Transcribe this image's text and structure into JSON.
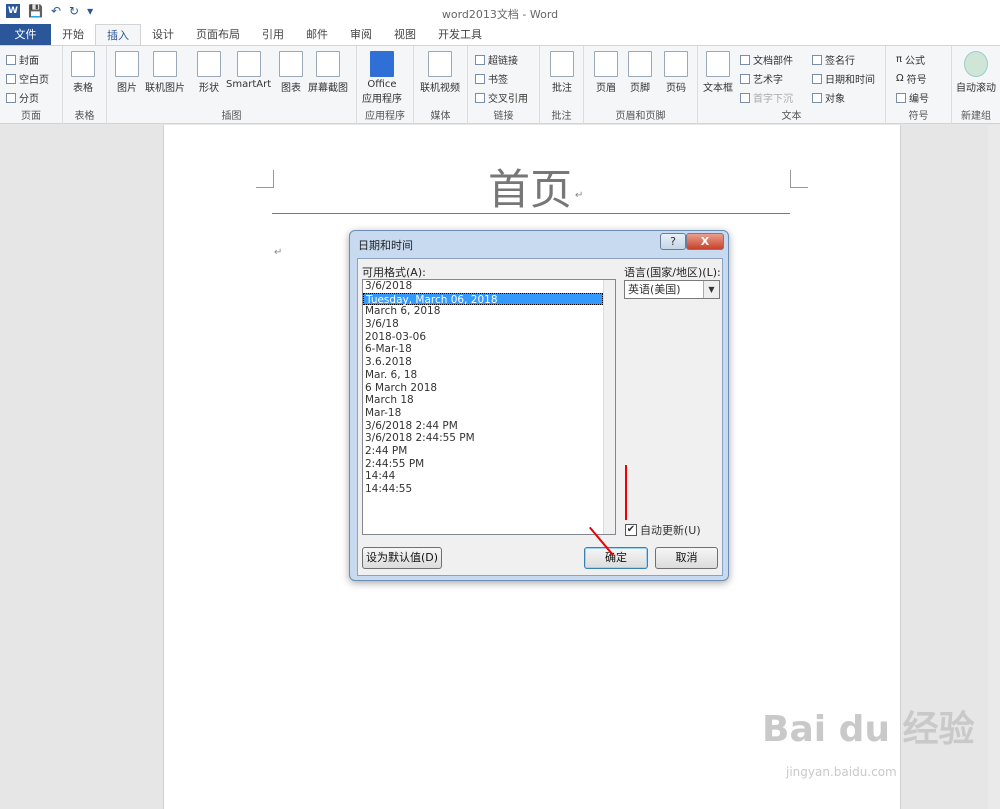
{
  "window": {
    "title": "word2013文档 - Word"
  },
  "qat": {
    "logo": "W"
  },
  "tabs": [
    "文件",
    "开始",
    "插入",
    "设计",
    "页面布局",
    "引用",
    "邮件",
    "审阅",
    "视图",
    "开发工具"
  ],
  "ribbon": {
    "groups": {
      "page": {
        "label": "页面",
        "items": [
          "封面",
          "空白页",
          "分页"
        ]
      },
      "table": {
        "label": "表格",
        "items": [
          "表格"
        ]
      },
      "illustrations": {
        "label": "插图",
        "items": [
          "图片",
          "联机图片",
          "形状",
          "SmartArt",
          "图表",
          "屏幕截图"
        ]
      },
      "apps": {
        "label": "应用程序",
        "items": [
          "Office",
          "应用程序"
        ]
      },
      "media": {
        "label": "媒体",
        "items": [
          "联机视频"
        ]
      },
      "links": {
        "label": "链接",
        "items": [
          "超链接",
          "书签",
          "交叉引用"
        ]
      },
      "comments": {
        "label": "批注",
        "items": [
          "批注"
        ]
      },
      "headerfooter": {
        "label": "页眉和页脚",
        "items": [
          "页眉",
          "页脚",
          "页码"
        ]
      },
      "text": {
        "label": "文本",
        "items": [
          "文本框",
          "文档部件",
          "艺术字",
          "首字下沉",
          "签名行",
          "日期和时间",
          "对象"
        ]
      },
      "symbols": {
        "label": "符号",
        "items": [
          "公式",
          "符号",
          "编号"
        ]
      },
      "newgroup": {
        "label": "新建组",
        "items": [
          "自动滚动"
        ]
      }
    }
  },
  "document": {
    "header_text": "首页"
  },
  "dialog": {
    "title": "日期和时间",
    "help": "?",
    "close": "X",
    "formats_label": "可用格式(A):",
    "formats": [
      "3/6/2018",
      "Tuesday, March 06, 2018",
      "March 6, 2018",
      "3/6/18",
      "2018-03-06",
      "6-Mar-18",
      "3.6.2018",
      "Mar. 6, 18",
      "6 March 2018",
      "March 18",
      "Mar-18",
      "3/6/2018 2:44 PM",
      "3/6/2018 2:44:55 PM",
      "2:44 PM",
      "2:44:55 PM",
      "14:44",
      "14:44:55"
    ],
    "selected_index": 1,
    "language_label": "语言(国家/地区)(L):",
    "language_value": "英语(美国)",
    "auto_update_label": "自动更新(U)",
    "auto_update_checked": true,
    "default_button": "设为默认值(D)",
    "ok_button": "确定",
    "cancel_button": "取消"
  },
  "watermark": {
    "main": "Bai du 经验",
    "sub": "jingyan.baidu.com"
  }
}
